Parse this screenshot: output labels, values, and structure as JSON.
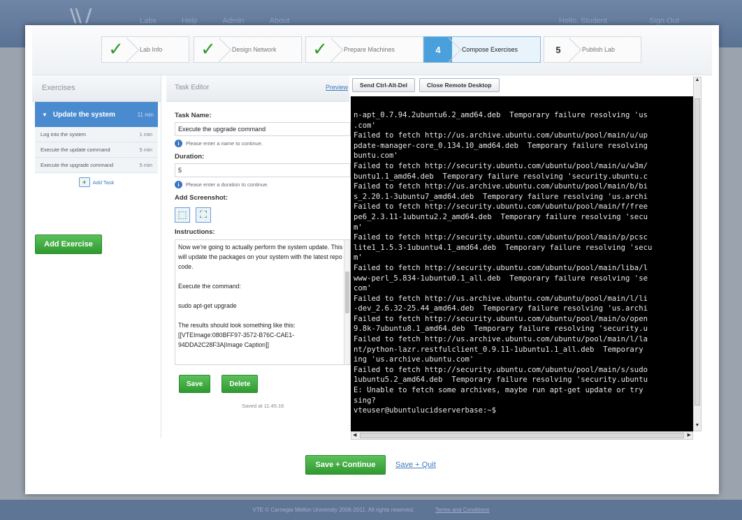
{
  "background": {
    "nav": [
      "Labs",
      "Help",
      "Admin",
      "About"
    ],
    "nav_right": [
      "Hello, Student",
      "Sign Out"
    ],
    "footer_text": "VTE © Carnegie Mellon University 2006-2011. All rights reserved.",
    "footer_link": "Terms and Conditions"
  },
  "wizard": {
    "steps": [
      {
        "label": "Lab Info",
        "state": "done"
      },
      {
        "label": "Design Network",
        "state": "done"
      },
      {
        "label": "Prepare Machines",
        "state": "done"
      },
      {
        "label": "Compose Exercises",
        "number": "4",
        "state": "active"
      },
      {
        "label": "Publish Lab",
        "number": "5",
        "state": "pending"
      }
    ]
  },
  "exercises": {
    "header": "Exercises",
    "active": {
      "title": "Update the system",
      "duration": "11 min"
    },
    "items": [
      {
        "title": "Log into the system",
        "duration": "1 min"
      },
      {
        "title": "Execute the update command",
        "duration": "5 min"
      },
      {
        "title": "Execute the upgrade command",
        "duration": "5 min"
      }
    ],
    "add_task": "Add Task",
    "add_exercise": "Add Exercise"
  },
  "editor": {
    "header": "Task Editor",
    "preview": "Preview",
    "task_name_label": "Task Name:",
    "task_name_value": "Execute the upgrade command",
    "task_name_hint": "Please enter a name to continue.",
    "duration_label": "Duration:",
    "duration_value": "5",
    "duration_hint": "Please enter a duration to continue.",
    "screenshot_label": "Add Screenshot:",
    "instructions_label": "Instructions:",
    "instructions": [
      "Now we're going to actually perform the system update.  This will update the packages on your system with the latest repo code.",
      "Execute the command:",
      "sudo apt-get upgrade",
      "The results should look something like this:\n[[VTEImage:080BFF97-3572-B76C-CAE1-94DDA2C28F3A|Image Caption]]"
    ],
    "save": "Save",
    "delete": "Delete",
    "saved_at": "Saved at 11:45:16"
  },
  "remote": {
    "ctrl_alt_del": "Send Ctrl-Alt-Del",
    "close": "Close Remote Desktop",
    "terminal_lines": [
      "n-apt_0.7.94.2ubuntu6.2_amd64.deb  Temporary failure resolving 'us",
      ".com'",
      "Failed to fetch http://us.archive.ubuntu.com/ubuntu/pool/main/u/up",
      "pdate-manager-core_0.134.10_amd64.deb  Temporary failure resolving",
      "buntu.com'",
      "Failed to fetch http://security.ubuntu.com/ubuntu/pool/main/u/w3m/",
      "buntu1.1_amd64.deb  Temporary failure resolving 'security.ubuntu.c",
      "Failed to fetch http://us.archive.ubuntu.com/ubuntu/pool/main/b/bi",
      "s_2.20.1-3ubuntu7_amd64.deb  Temporary failure resolving 'us.archi",
      "Failed to fetch http://security.ubuntu.com/ubuntu/pool/main/f/free",
      "pe6_2.3.11-1ubuntu2.2_amd64.deb  Temporary failure resolving 'secu",
      "m'",
      "Failed to fetch http://security.ubuntu.com/ubuntu/pool/main/p/pcsc",
      "lite1_1.5.3-1ubuntu4.1_amd64.deb  Temporary failure resolving 'secu",
      "m'",
      "Failed to fetch http://security.ubuntu.com/ubuntu/pool/main/liba/l",
      "www-perl_5.834-1ubuntu0.1_all.deb  Temporary failure resolving 'se",
      "com'",
      "Failed to fetch http://us.archive.ubuntu.com/ubuntu/pool/main/l/li",
      "-dev_2.6.32-25.44_amd64.deb  Temporary failure resolving 'us.archi",
      "Failed to fetch http://security.ubuntu.com/ubuntu/pool/main/o/open",
      "9.8k-7ubuntu8.1_amd64.deb  Temporary failure resolving 'security.u",
      "Failed to fetch http://us.archive.ubuntu.com/ubuntu/pool/main/l/la",
      "nt/python-lazr.restfulclient_0.9.11-1ubuntu1.1_all.deb  Temporary",
      "ing 'us.archive.ubuntu.com'",
      "Failed to fetch http://security.ubuntu.com/ubuntu/pool/main/s/sudo",
      "1ubuntu5.2_amd64.deb  Temporary failure resolving 'security.ubuntu",
      "E: Unable to fetch some archives, maybe run apt-get update or try",
      "sing?",
      "vteuser@ubuntulucidserverbase:~$"
    ]
  },
  "actions": {
    "save_continue": "Save + Continue",
    "save_quit": "Save + Quit"
  },
  "colors": {
    "accent_blue": "#4a8bd0",
    "success_green": "#2f9a30",
    "link_blue": "#3d7abf"
  }
}
